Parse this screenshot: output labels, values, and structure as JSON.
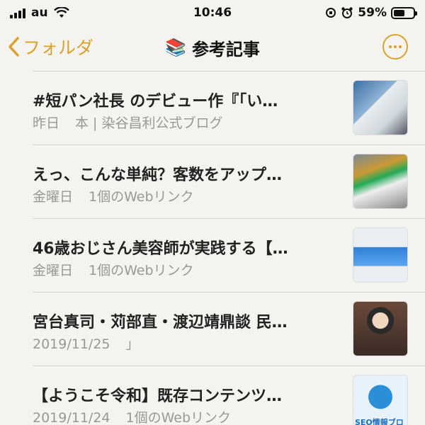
{
  "status": {
    "carrier": "au",
    "time": "10:46",
    "battery": "59%"
  },
  "nav": {
    "back_label": "フォルダ",
    "title_emoji": "📚",
    "title": "参考記事"
  },
  "notes": [
    {
      "title": "#短パン社長 のデビュー作『「い…",
      "date": "昨日",
      "subtitle": "本 | 染谷昌利公式ブログ"
    },
    {
      "title": "えっ、こんな単純？客数をアップ…",
      "date": "金曜日",
      "subtitle": "1個のWebリンク"
    },
    {
      "title": "46歳おじさん美容師が実践する【…",
      "date": "金曜日",
      "subtitle": "1個のWebリンク"
    },
    {
      "title": "宮台真司・苅部直・渡辺靖鼎談 民…",
      "date": "2019/11/25",
      "subtitle": "」"
    },
    {
      "title": "【ようこそ令和】既存コンテンツ…",
      "date": "2019/11/24",
      "subtitle": "1個のWebリンク",
      "thumb_text": "SEO情報ブロ"
    }
  ],
  "colors": {
    "accent": "#d8a22e",
    "meta": "#9a9894",
    "divider": "#d9d6d0"
  }
}
